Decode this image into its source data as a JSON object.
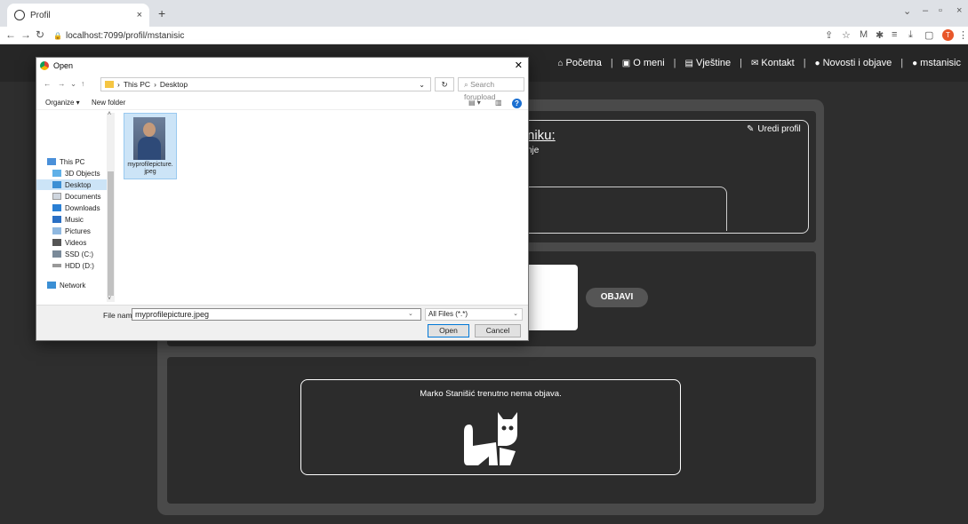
{
  "browser": {
    "tab_title": "Profil",
    "tab_close": "×",
    "new_tab": "+",
    "url": "localhost:7099/profil/mstanisic",
    "profile_initial": "T"
  },
  "nav": {
    "items": [
      {
        "label": "Početna",
        "icon": "home-icon"
      },
      {
        "label": "O meni",
        "icon": "id-card-icon"
      },
      {
        "label": "Vještine",
        "icon": "book-icon"
      },
      {
        "label": "Kontakt",
        "icon": "envelope-icon"
      },
      {
        "label": "Novosti i objave",
        "icon": "comments-icon"
      },
      {
        "label": "mstanisic",
        "icon": "user-icon"
      }
    ]
  },
  "profile": {
    "heading_partial": "niku:",
    "sub_partial": "nje",
    "edit_label": "Uredi profil"
  },
  "post": {
    "publish_label": "OBJAVI"
  },
  "feed": {
    "empty_text": "Marko Stanišić trenutno nema objava."
  },
  "dialog": {
    "title": "Open",
    "path": [
      "This PC",
      "Desktop"
    ],
    "search_placeholder": "Search forupload",
    "organize": "Organize ▾",
    "new_folder": "New folder",
    "sidebar": [
      {
        "label": "This PC",
        "icon": "computer-icon"
      },
      {
        "label": "3D Objects",
        "icon": "cube-icon"
      },
      {
        "label": "Desktop",
        "icon": "desktop-icon"
      },
      {
        "label": "Documents",
        "icon": "document-icon"
      },
      {
        "label": "Downloads",
        "icon": "download-icon"
      },
      {
        "label": "Music",
        "icon": "music-icon"
      },
      {
        "label": "Pictures",
        "icon": "picture-icon"
      },
      {
        "label": "Videos",
        "icon": "video-icon"
      },
      {
        "label": "SSD (C:)",
        "icon": "drive-icon"
      },
      {
        "label": "HDD (D:)",
        "icon": "drive-icon"
      },
      {
        "label": "Network",
        "icon": "network-icon"
      }
    ],
    "file_name_line1": "myprofilepicture.",
    "file_name_line2": "jpeg",
    "file_name_label": "File name:",
    "file_name_value": "myprofilepicture.jpeg",
    "file_type": "All Files (*.*)",
    "open_label": "Open",
    "cancel_label": "Cancel"
  }
}
